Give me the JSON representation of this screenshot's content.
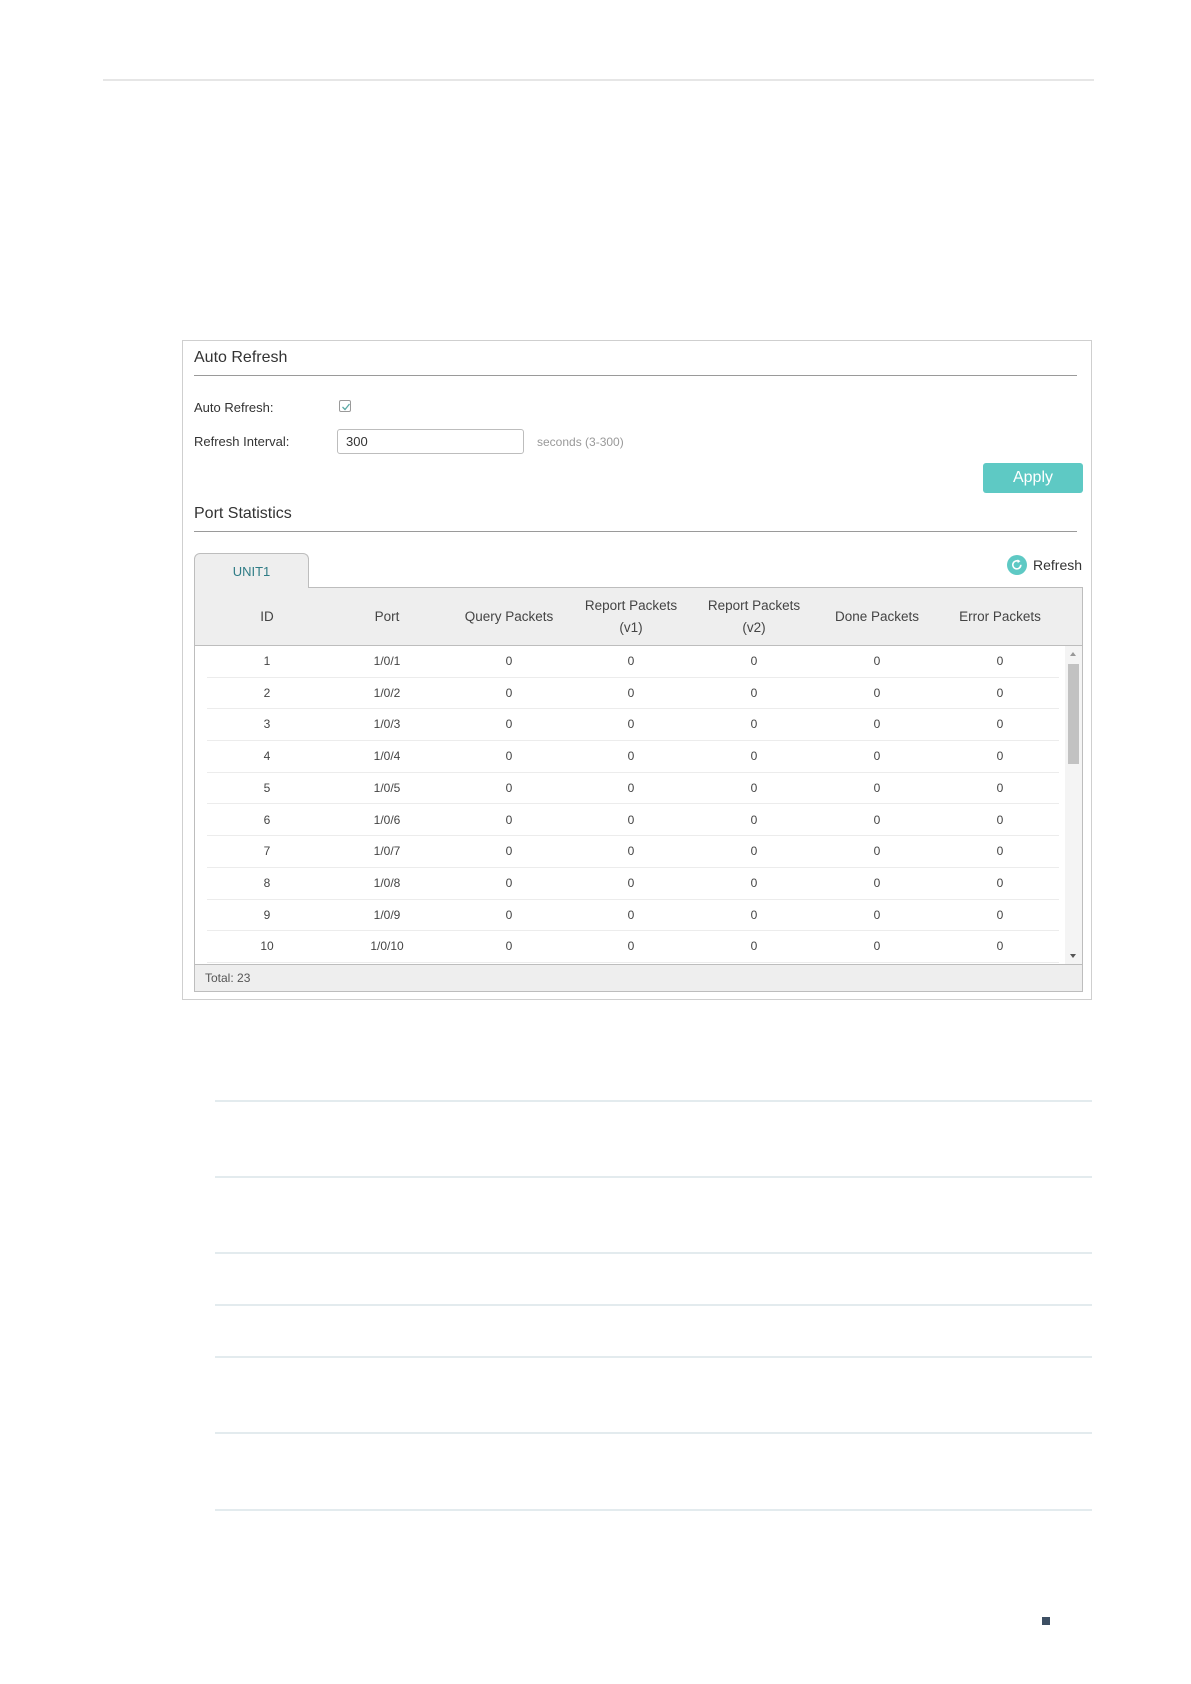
{
  "auto_refresh": {
    "section_title": "Auto Refresh",
    "auto_refresh_label": "Auto Refresh:",
    "auto_refresh_checked": true,
    "interval_label": "Refresh Interval:",
    "interval_value": "300",
    "interval_hint": "seconds (3-300)",
    "apply_label": "Apply"
  },
  "port_statistics": {
    "section_title": "Port Statistics",
    "tab_label": "UNIT1",
    "refresh_label": "Refresh",
    "columns": [
      "ID",
      "Port",
      "Query Packets",
      "Report Packets (v1)",
      "Report Packets (v2)",
      "Done Packets",
      "Error Packets"
    ],
    "rows": [
      [
        "1",
        "1/0/1",
        "0",
        "0",
        "0",
        "0",
        "0"
      ],
      [
        "2",
        "1/0/2",
        "0",
        "0",
        "0",
        "0",
        "0"
      ],
      [
        "3",
        "1/0/3",
        "0",
        "0",
        "0",
        "0",
        "0"
      ],
      [
        "4",
        "1/0/4",
        "0",
        "0",
        "0",
        "0",
        "0"
      ],
      [
        "5",
        "1/0/5",
        "0",
        "0",
        "0",
        "0",
        "0"
      ],
      [
        "6",
        "1/0/6",
        "0",
        "0",
        "0",
        "0",
        "0"
      ],
      [
        "7",
        "1/0/7",
        "0",
        "0",
        "0",
        "0",
        "0"
      ],
      [
        "8",
        "1/0/8",
        "0",
        "0",
        "0",
        "0",
        "0"
      ],
      [
        "9",
        "1/0/9",
        "0",
        "0",
        "0",
        "0",
        "0"
      ],
      [
        "10",
        "1/0/10",
        "0",
        "0",
        "0",
        "0",
        "0"
      ]
    ],
    "total_label": "Total: 23"
  },
  "icons": {
    "checkbox": "check-icon",
    "refresh": "refresh-icon",
    "scroll_up": "scroll-up-icon",
    "scroll_down": "scroll-down-icon"
  },
  "colors": {
    "accent": "#5ec9c4",
    "tab_text": "#2f7c86",
    "header_bg": "#eeeeee"
  }
}
